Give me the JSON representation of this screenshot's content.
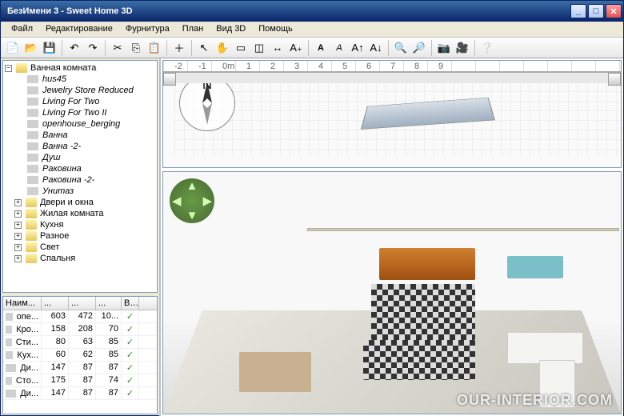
{
  "window": {
    "title": "БезИмени 3 - Sweet Home 3D"
  },
  "menu": [
    "Файл",
    "Редактирование",
    "Фурнитура",
    "План",
    "Вид 3D",
    "Помощь"
  ],
  "tree": {
    "root": "Ванная комната",
    "items": [
      "hus45",
      "Jewelry Store Reduced",
      "Living For Two",
      "Living For Two II",
      "openhouse_berging",
      "Ванна",
      "Ванна -2-",
      "Душ",
      "Раковина",
      "Раковина -2-",
      "Унитаз"
    ],
    "cats": [
      "Двери и окна",
      "Жилая комната",
      "Кухня",
      "Разное",
      "Свет",
      "Спальня"
    ]
  },
  "table": {
    "headers": [
      "Наим...",
      "...",
      "...",
      "...",
      "В..."
    ],
    "rows": [
      {
        "n": "опе...",
        "a": 603,
        "b": 472,
        "c": "10...",
        "v": "✓"
      },
      {
        "n": "Кро...",
        "a": 158,
        "b": 208,
        "c": 70,
        "v": "✓"
      },
      {
        "n": "Сти...",
        "a": 80,
        "b": 63,
        "c": 85,
        "v": "✓"
      },
      {
        "n": "Кух...",
        "a": 60,
        "b": 62,
        "c": 85,
        "v": "✓"
      },
      {
        "n": "Ди...",
        "a": 147,
        "b": 87,
        "c": 87,
        "v": "✓"
      },
      {
        "n": "Сто...",
        "a": 175,
        "b": 87,
        "c": 74,
        "v": "✓"
      },
      {
        "n": "Ди...",
        "a": 147,
        "b": 87,
        "c": 87,
        "v": "✓"
      }
    ]
  },
  "ruler": [
    "-2",
    "-1",
    "0m",
    "1",
    "2",
    "3",
    "4",
    "5",
    "6",
    "7",
    "8",
    "9"
  ],
  "compass_label": "N",
  "watermark": "OUR-INTERIOR.COM"
}
